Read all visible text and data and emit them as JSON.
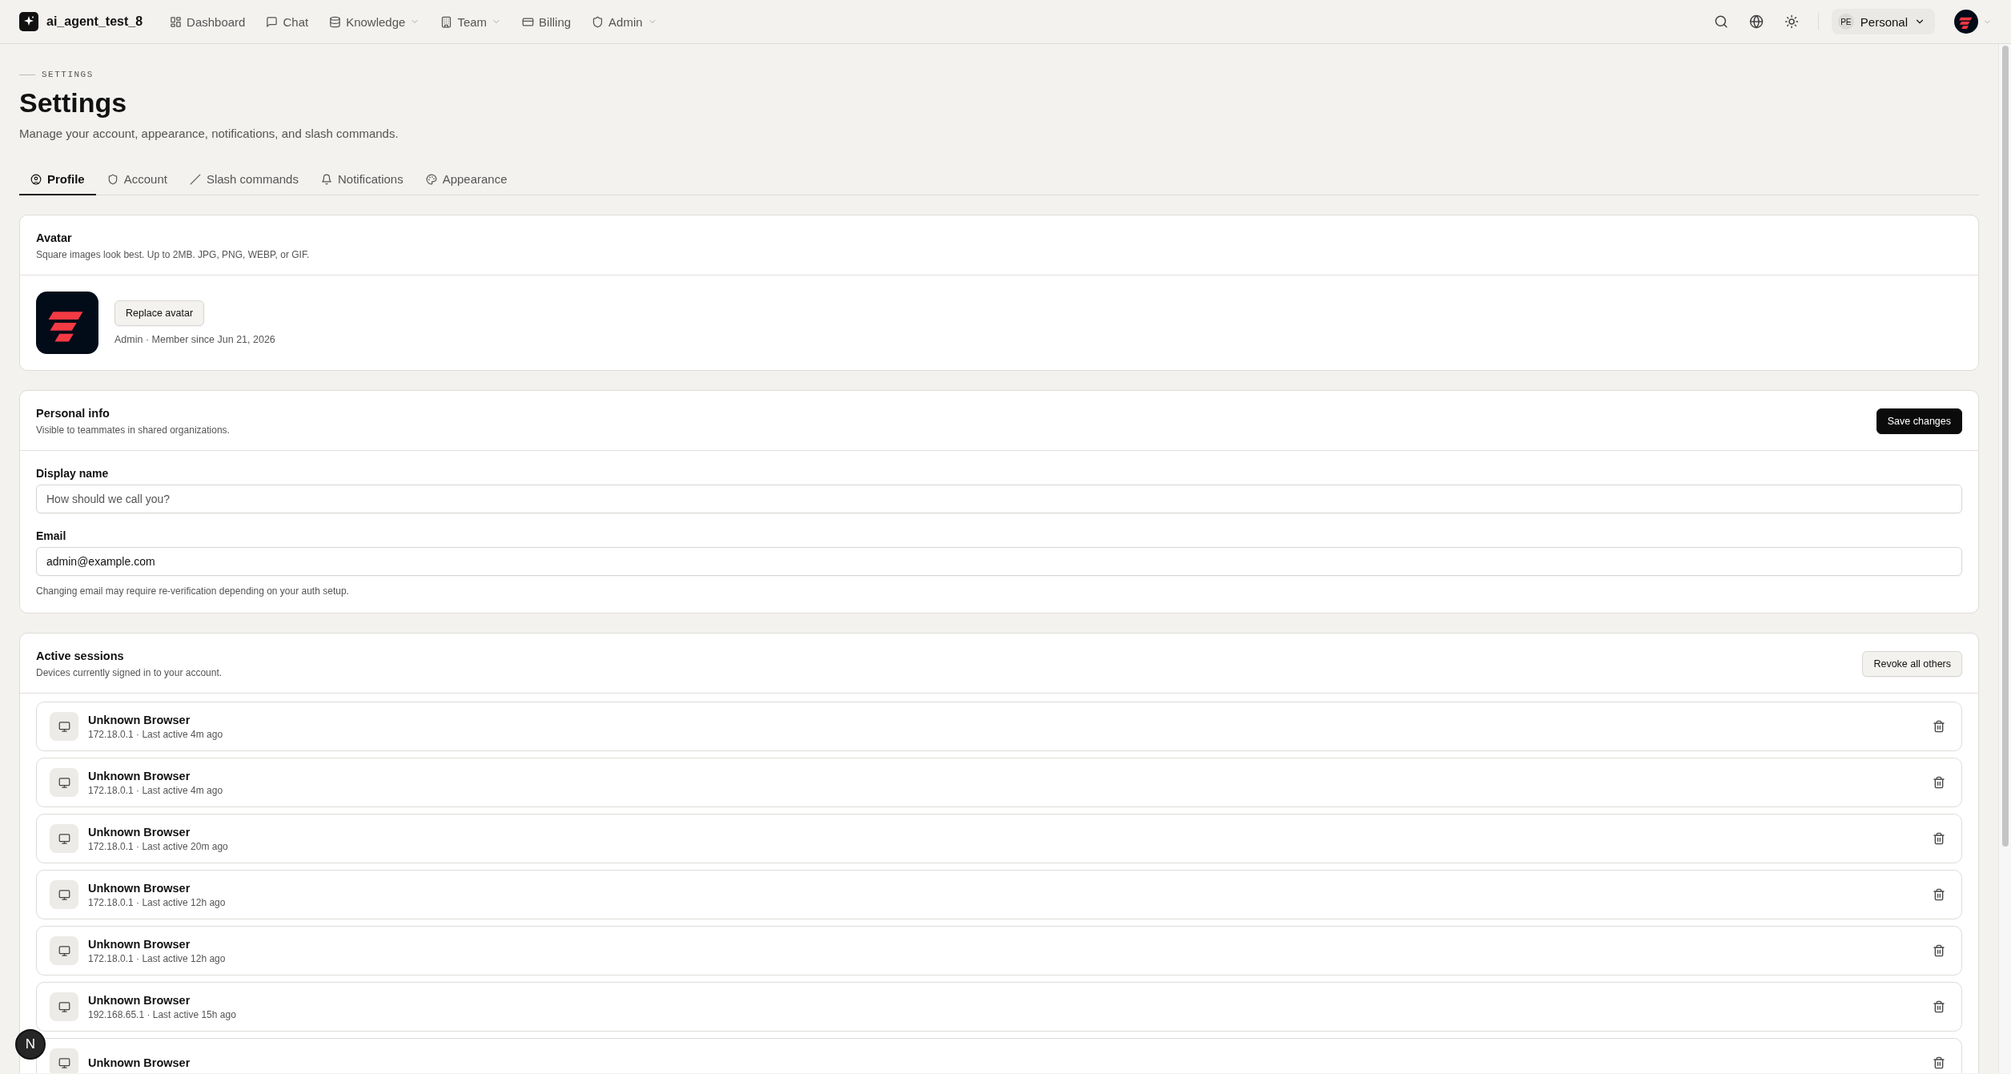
{
  "nav": {
    "brand": "ai_agent_test_8",
    "items": [
      {
        "label": "Dashboard",
        "kind": "grid",
        "has_menu": false
      },
      {
        "label": "Chat",
        "kind": "chat",
        "has_menu": false
      },
      {
        "label": "Knowledge",
        "kind": "database",
        "has_menu": true
      },
      {
        "label": "Team",
        "kind": "building",
        "has_menu": true
      },
      {
        "label": "Billing",
        "kind": "card",
        "has_menu": false
      },
      {
        "label": "Admin",
        "kind": "shield",
        "has_menu": true
      }
    ],
    "workspace": {
      "badge": "PE",
      "label": "Personal"
    }
  },
  "page": {
    "eyebrow": "SETTINGS",
    "title": "Settings",
    "subtitle": "Manage your account, appearance, notifications, and slash commands."
  },
  "tabs": [
    {
      "label": "Profile",
      "kind": "user",
      "selected": true
    },
    {
      "label": "Account",
      "kind": "shield",
      "selected": false
    },
    {
      "label": "Slash commands",
      "kind": "slash",
      "selected": false
    },
    {
      "label": "Notifications",
      "kind": "bell",
      "selected": false
    },
    {
      "label": "Appearance",
      "kind": "palette",
      "selected": false
    }
  ],
  "avatar_card": {
    "title": "Avatar",
    "description": "Square images look best. Up to 2MB. JPG, PNG, WEBP, or GIF.",
    "button": "Replace avatar",
    "meta": "Admin · Member since Jun 21, 2026"
  },
  "personal_info": {
    "title": "Personal info",
    "description": "Visible to teammates in shared organizations.",
    "button": "Save changes",
    "fields": [
      {
        "label": "Display name",
        "placeholder": "How should we call you?"
      },
      {
        "label": "Email",
        "value": "admin@example.com"
      }
    ],
    "hint": "Changing email may require re-verification depending on your auth setup."
  },
  "sessions": {
    "title": "Active sessions",
    "description": "Devices currently signed in to your account.",
    "button": "Revoke all others",
    "rows": [
      {
        "title": "Unknown Browser",
        "detail": "172.18.0.1 · Last active 4m ago"
      },
      {
        "title": "Unknown Browser",
        "detail": "172.18.0.1 · Last active 4m ago"
      },
      {
        "title": "Unknown Browser",
        "detail": "172.18.0.1 · Last active 20m ago"
      },
      {
        "title": "Unknown Browser",
        "detail": "172.18.0.1 · Last active 12h ago"
      },
      {
        "title": "Unknown Browser",
        "detail": "172.18.0.1 · Last active 12h ago"
      },
      {
        "title": "Unknown Browser",
        "detail": "192.168.65.1 · Last active 15h ago"
      },
      {
        "title": "Unknown Browser"
      }
    ]
  },
  "dev_badge": "N"
}
